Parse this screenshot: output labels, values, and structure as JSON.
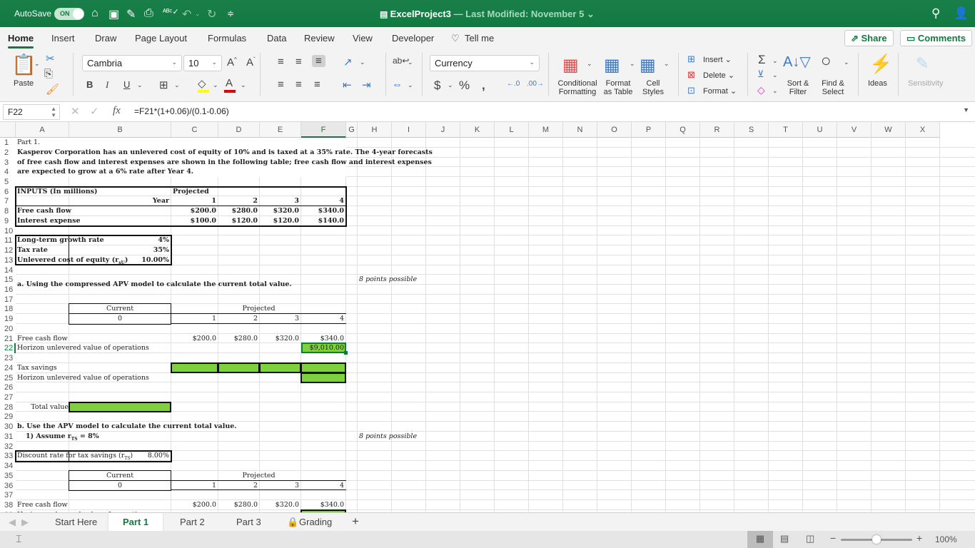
{
  "titlebar": {
    "autosave_label": "AutoSave",
    "autosave_state": "ON",
    "doc_name": "ExcelProject3",
    "modified": " — Last Modified: November 5",
    "qat_icons": [
      "home-icon",
      "save-icon",
      "edit-icon",
      "print-icon",
      "spellcheck-icon",
      "undo-icon",
      "redo-icon",
      "customize-icon"
    ]
  },
  "menu": {
    "tabs": [
      "Home",
      "Insert",
      "Draw",
      "Page Layout",
      "Formulas",
      "Data",
      "Review",
      "View",
      "Developer",
      "Tell me"
    ],
    "active": "Home",
    "share": "Share",
    "comments": "Comments"
  },
  "ribbon": {
    "paste": "Paste",
    "font_name": "Cambria",
    "font_size": "10",
    "number_format": "Currency",
    "conditional_formatting": [
      "Conditional",
      "Formatting"
    ],
    "format_as_table": [
      "Format",
      "as Table"
    ],
    "cell_styles": [
      "Cell",
      "Styles"
    ],
    "insert": "Insert",
    "delete": "Delete",
    "format": "Format",
    "sort_filter": [
      "Sort &",
      "Filter"
    ],
    "find_select": [
      "Find &",
      "Select"
    ],
    "ideas": "Ideas",
    "sensitivity": "Sensitivity",
    "colors": {
      "highlight": "#ffff00",
      "font": "#e00000"
    }
  },
  "formula_bar": {
    "name_box": "F22",
    "formula": "=F21*(1+0.06)/(0.1-0.06)"
  },
  "columns": [
    "A",
    "B",
    "C",
    "D",
    "E",
    "F",
    "G",
    "H",
    "I",
    "J",
    "K",
    "L",
    "M",
    "N",
    "O",
    "P",
    "Q",
    "R",
    "S",
    "T",
    "U",
    "V",
    "W",
    "X"
  ],
  "selected_cell": {
    "col": "F",
    "row": 22
  },
  "sheet": {
    "r1": "Part 1.",
    "r2": "Kasperov Corporation has an unlevered cost of equity of 10% and is taxed at a 35% rate. The 4-year forecasts",
    "r3": "of free cash flow and interest expenses are shown in the following table; free cash flow and interest expenses",
    "r4": "are expected to grow at a 6% rate after Year 4.",
    "inputs_title": "INPUTS (In millions)",
    "projected": "Projected",
    "year_label": "Year",
    "years": [
      "1",
      "2",
      "3",
      "4"
    ],
    "fcf_label": "Free cash flow",
    "fcf": [
      "$200.0",
      "$280.0",
      "$320.0",
      "$340.0"
    ],
    "interest_label": "Interest expense",
    "interest": [
      "$100.0",
      "$120.0",
      "$120.0",
      "$140.0"
    ],
    "growth_label": "Long-term growth rate",
    "growth": "4%",
    "tax_label": "Tax rate",
    "tax": "35%",
    "rsu_label": "Unlevered cost of equity (r",
    "rsu_sub": "sU",
    "rsu": "10.00%",
    "part_a": "a. Using the compressed APV model to calculate the current total value.",
    "points": "8 points possible",
    "current": "Current",
    "zero": "0",
    "horizon_label": "Horizon unlevered value of operations",
    "horizon_value": "$9,010.00",
    "tax_savings_label": "Tax savings",
    "total_value_label": "Total value",
    "part_b": "b. Use the APV model to calculate the current total value.",
    "assume": "1) Assume r",
    "assume_sub": "TS",
    "assume_tail": " = 8%",
    "discount_label": "Discount rate for tax savings (r",
    "discount_sub": "TS",
    "discount": "8.00%"
  },
  "sheet_tabs": [
    "Start Here",
    "Part 1",
    "Part 2",
    "Part 3",
    "Grading"
  ],
  "active_sheet": "Part 1",
  "status": {
    "zoom": "100%",
    "zoom_fraction": 0.5
  }
}
